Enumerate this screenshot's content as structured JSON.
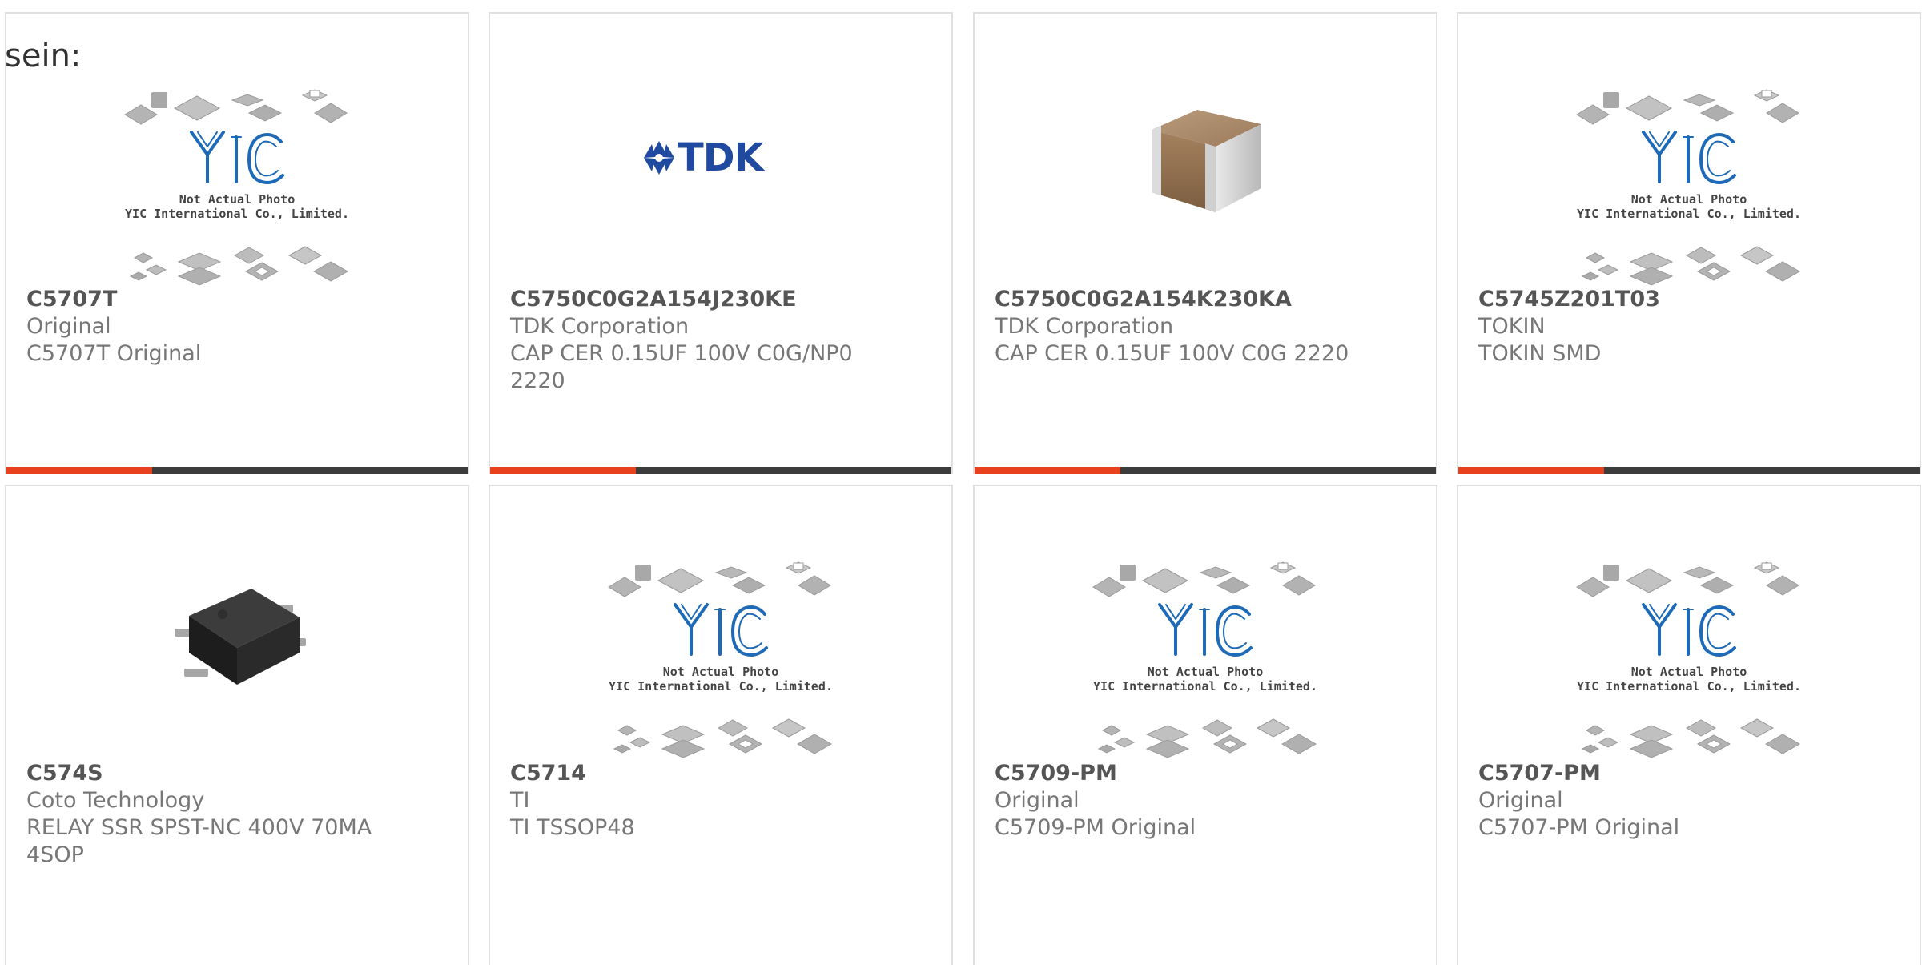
{
  "intro_text": "sein:",
  "accent_color": "#e8411e",
  "placeholder": {
    "logo": "YIC",
    "line1": "Not Actual Photo",
    "line2": "YIC International Co., Limited."
  },
  "tdk_logo_text": "TDK",
  "products": [
    {
      "part": "C5707T",
      "manufacturer": "Original",
      "description": "C5707T Original",
      "image": "yic-placeholder"
    },
    {
      "part": "C5750C0G2A154J230KE",
      "manufacturer": "TDK Corporation",
      "description": "CAP CER 0.15UF 100V C0G/NP0 2220",
      "image": "tdk-logo"
    },
    {
      "part": "C5750C0G2A154K230KA",
      "manufacturer": "TDK Corporation",
      "description": "CAP CER 0.15UF 100V C0G 2220",
      "image": "ceramic-capacitor-photo"
    },
    {
      "part": "C5745Z201T03",
      "manufacturer": "TOKIN",
      "description": "TOKIN SMD",
      "image": "yic-placeholder"
    },
    {
      "part": "C574S",
      "manufacturer": "Coto Technology",
      "description": "RELAY SSR SPST-NC 400V 70MA 4SOP",
      "image": "relay-sop-photo"
    },
    {
      "part": "C5714",
      "manufacturer": "TI",
      "description": "TI TSSOP48",
      "image": "yic-placeholder"
    },
    {
      "part": "C5709-PM",
      "manufacturer": "Original",
      "description": "C5709-PM Original",
      "image": "yic-placeholder"
    },
    {
      "part": "C5707-PM",
      "manufacturer": "Original",
      "description": "C5707-PM Original",
      "image": "yic-placeholder"
    }
  ]
}
